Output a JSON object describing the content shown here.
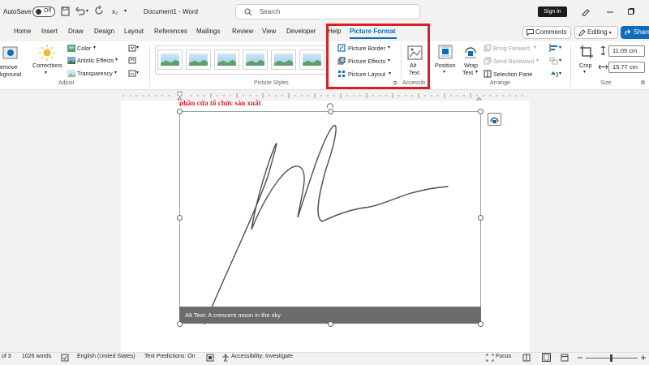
{
  "titlebar": {
    "autosave": "AutoSave",
    "autosave_state": "Off",
    "doc_title": "Document1 - Word",
    "search_placeholder": "Search",
    "signin": "Sign in",
    "subscript": "x₂"
  },
  "tabs": [
    "Home",
    "Insert",
    "Draw",
    "Design",
    "Layout",
    "References",
    "Mailings",
    "Review",
    "View",
    "Developer",
    "Help",
    "Picture Format"
  ],
  "tab_buttons": {
    "comments": "Comments",
    "editing": "Editing",
    "share": "Share"
  },
  "ribbon": {
    "adjust": {
      "remove_bg_1": "emove",
      "remove_bg_2": "kground",
      "corrections": "Corrections",
      "color": "Color",
      "artistic": "Artistic Effects",
      "transparency": "Transparency",
      "group": "Adjust"
    },
    "styles": {
      "group": "Picture Styles"
    },
    "accessibility": {
      "border": "Picture Border",
      "effects": "Picture Effects",
      "layout": "Picture Layout",
      "alt_1": "Alt",
      "alt_2": "Text",
      "group": "Accessib..."
    },
    "arrange": {
      "position": "Position",
      "wrap_1": "Wrap",
      "wrap_2": "Text",
      "bring_forward": "Bring Forward",
      "send_backward": "Send Backward",
      "selection_pane": "Selection Pane",
      "group": "Arrange"
    },
    "size": {
      "crop": "Crop",
      "height": "11.09 cm",
      "width": "15.77 cm",
      "group": "Size"
    }
  },
  "document": {
    "heading_fragment": "phần cửa tổ chức sản xuất",
    "alt_text": "Alt Text: A crescent moon in the sky"
  },
  "status": {
    "pages": "of 3",
    "words": "1026 words",
    "language": "English (United States)",
    "predictions": "Text Predictions: On",
    "accessibility": "Accessibility: Investigate",
    "focus": "Focus"
  },
  "colors": {
    "accent": "#0f6cbd",
    "highlight": "#d6202a",
    "alt_bar": "#6b6b6b"
  }
}
